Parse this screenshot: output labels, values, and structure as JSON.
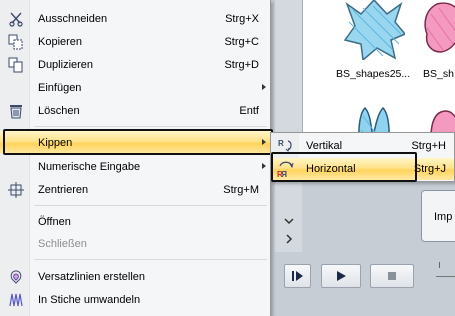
{
  "context_menu": {
    "items": [
      {
        "label": "Ausschneiden",
        "shortcut": "Strg+X",
        "icon": "scissors-icon"
      },
      {
        "label": "Kopieren",
        "shortcut": "Strg+C",
        "icon": "copy-icon"
      },
      {
        "label": "Duplizieren",
        "shortcut": "Strg+D",
        "icon": "duplicate-icon"
      },
      {
        "label": "Einfügen",
        "shortcut": "",
        "icon": ""
      },
      {
        "label": "Löschen",
        "shortcut": "Entf",
        "icon": "trash-icon"
      },
      {
        "label": "Kippen",
        "shortcut": "",
        "icon": ""
      },
      {
        "label": "Numerische Eingabe",
        "shortcut": "",
        "icon": ""
      },
      {
        "label": "Zentrieren",
        "shortcut": "Strg+M",
        "icon": "center-icon"
      },
      {
        "label": "Öffnen",
        "shortcut": "",
        "icon": ""
      },
      {
        "label": "Schließen",
        "shortcut": "",
        "icon": ""
      },
      {
        "label": "Versatzlinien erstellen",
        "shortcut": "",
        "icon": "offset-lines-icon"
      },
      {
        "label": "In Stiche umwandeln",
        "shortcut": "",
        "icon": "convert-stitches-icon"
      }
    ]
  },
  "submenu": {
    "items": [
      {
        "label": "Vertikal",
        "shortcut": "Strg+H",
        "icon": "flip-vertical-icon"
      },
      {
        "label": "Horizontal",
        "shortcut": "Strg+J",
        "icon": "flip-horizontal-icon"
      }
    ]
  },
  "gallery": {
    "labels": [
      "BS_shapes25...",
      "BS_sh"
    ]
  },
  "import_button": {
    "label": "Imp"
  },
  "colors": {
    "highlight": "#ffd45c",
    "shape_blue": "#8fd3f0",
    "shape_pink": "#f49ac1"
  }
}
